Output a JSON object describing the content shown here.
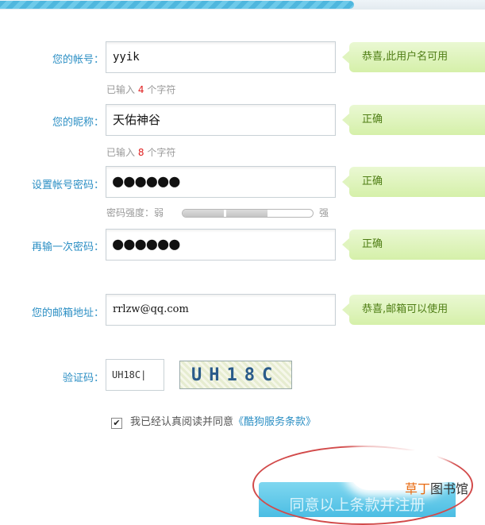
{
  "form": {
    "account": {
      "label": "您的帐号：",
      "value": "yyik",
      "tip": "恭喜,此用户名可用",
      "hint_pre": "已输入",
      "hint_count": "4",
      "hint_post": "个字符"
    },
    "nickname": {
      "label": "您的昵称：",
      "value": "天佑神谷",
      "tip": "正确",
      "hint_pre": "已输入",
      "hint_count": "8",
      "hint_post": "个字符"
    },
    "password": {
      "label": "设置帐号密码：",
      "value": "●●●●●●",
      "tip": "正确",
      "strength_label": "密码强度：弱",
      "strength_high": "强",
      "strength_level": 0.62
    },
    "confirm_password": {
      "label": "再输一次密码：",
      "value": "●●●●●●",
      "tip": "正确"
    },
    "email": {
      "label": "您的邮箱地址：",
      "value": "rrlzw@qq.com",
      "tip": "恭喜,邮箱可以使用"
    },
    "captcha": {
      "label": "验证码：",
      "value": "UH18C|",
      "image_text": "UH18C"
    },
    "agreement": {
      "checkbox": "✔",
      "text": "我已经认真阅读并同意",
      "link": "《酷狗服务条款》"
    },
    "submit_label": "同意以上条款并注册"
  },
  "watermark": {
    "highlight": "草丁",
    "rest": "图书馆"
  },
  "colors": {
    "label_blue": "#2c8fc4",
    "tip_green": "#d5f0a9",
    "error_red": "#e02020",
    "button_blue": "#4bbde3",
    "annotation_red": "#d24a4a"
  }
}
